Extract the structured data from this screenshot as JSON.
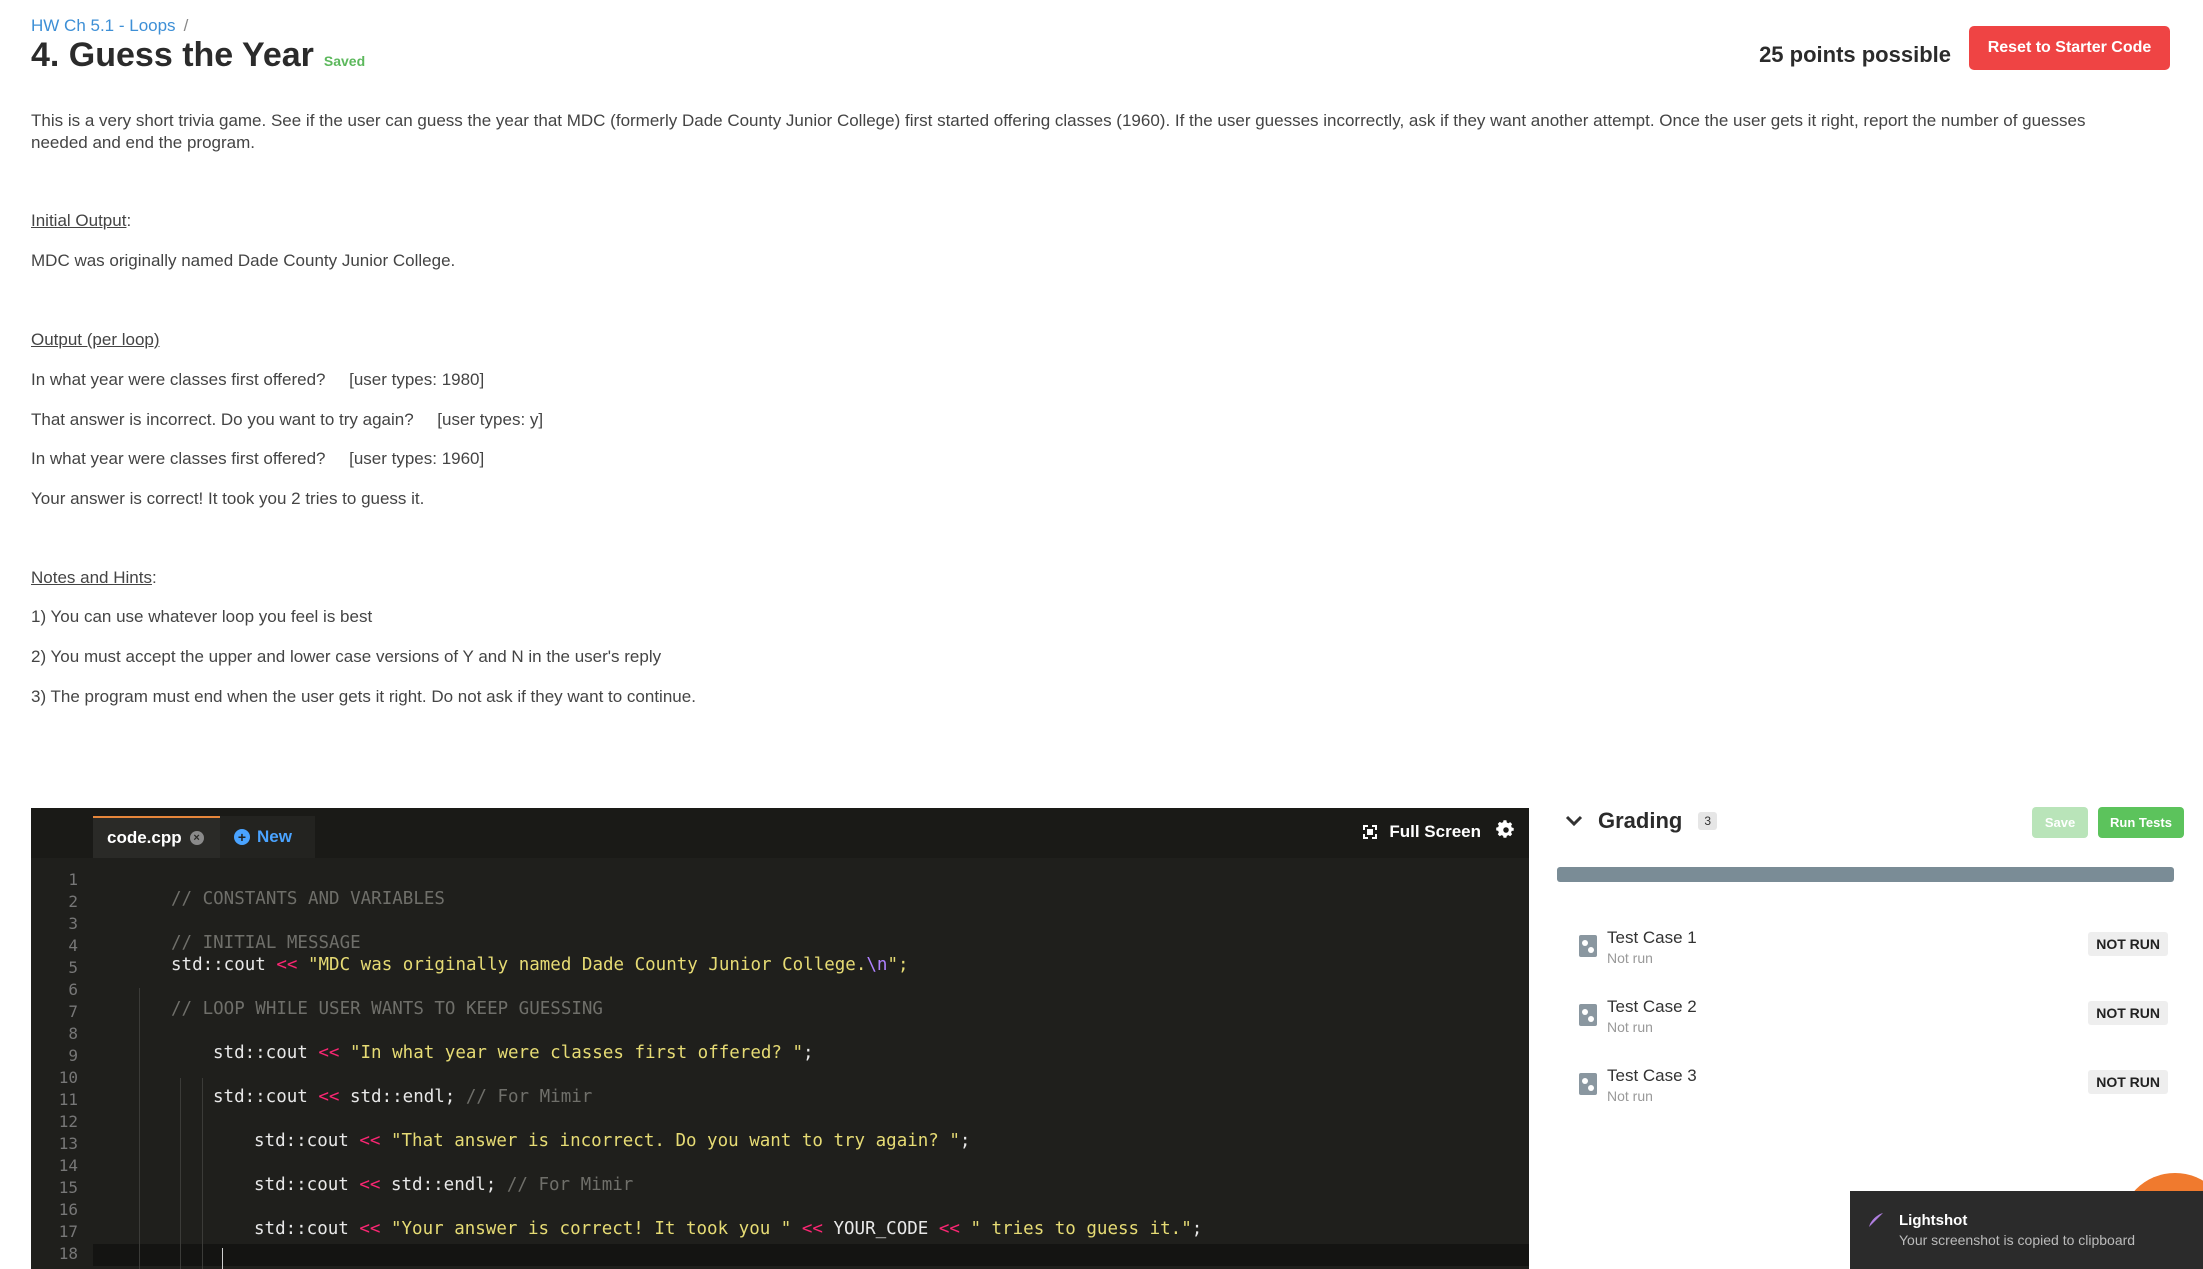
{
  "breadcrumb": {
    "link": "HW Ch 5.1 - Loops",
    "sep": "/"
  },
  "header": {
    "title": "4. Guess the Year",
    "saved": "Saved",
    "points": "25 points possible",
    "reset_label": "Reset to Starter Code"
  },
  "description": "This is a very short trivia game. See if the user can guess the year that MDC (formerly Dade County Junior College) first started offering classes (1960). If the user guesses incorrectly, ask if they want another attempt. Once the user gets it right, report the number of guesses needed and end the program.",
  "initial_output": {
    "heading": "Initial Output",
    "colon": ":",
    "lines": [
      "MDC was originally named Dade County Junior College."
    ]
  },
  "loop_output": {
    "heading": "Output (per loop)",
    "lines": [
      "In what year were classes first offered?     [user types: 1980]",
      "That answer is incorrect. Do you want to try again?     [user types: y]",
      "In what year were classes first offered?     [user types: 1960]",
      "Your answer is correct! It took you 2 tries to guess it."
    ]
  },
  "notes": {
    "heading": "Notes and Hints",
    "colon": ":",
    "lines": [
      "1) You can use whatever loop you feel is best",
      "2) You must accept the upper and lower case versions of Y and N in the user's reply",
      "3) The program must end when the user gets it right. Do not ask if they want to continue."
    ]
  },
  "editor": {
    "file_tab": "code.cpp",
    "new_tab": "New",
    "fullscreen_label": "Full Screen",
    "line_numbers": [
      "1",
      "2",
      "3",
      "4",
      "5",
      "6",
      "7",
      "8",
      "9",
      "10",
      "11",
      "12",
      "13",
      "14",
      "15",
      "16",
      "17",
      "18"
    ],
    "code": {
      "l2": "// CONSTANTS AND VARIABLES",
      "l4": "// INITIAL MESSAGE",
      "l5_a": "std::cout ",
      "l5_op": "<<",
      "l5_str": " \"MDC was originally named Dade County Junior College.",
      "l5_esc": "\\n",
      "l5_end": "\";",
      "l7": "// LOOP WHILE USER WANTS TO KEEP GUESSING",
      "l9_a": "std::cout ",
      "l9_op": "<<",
      "l9_str": " \"In what year were classes first offered? \"",
      "l9_end": ";",
      "l11_a": "std::cout ",
      "l11_op": "<<",
      "l11_b": " std::endl; ",
      "l11_cm": "// For Mimir",
      "l13_a": "std::cout ",
      "l13_op": "<<",
      "l13_str": " \"That answer is incorrect. Do you want to try again? \"",
      "l13_end": ";",
      "l15_a": "std::cout ",
      "l15_op": "<<",
      "l15_b": " std::endl; ",
      "l15_cm": "// For Mimir",
      "l17_a": "std::cout ",
      "l17_op1": "<<",
      "l17_str1": " \"Your answer is correct! It took you \" ",
      "l17_op2": "<<",
      "l17_b": " YOUR_CODE ",
      "l17_op3": "<<",
      "l17_str2": " \" tries to guess it.\"",
      "l17_end": ";"
    }
  },
  "grading": {
    "title": "Grading",
    "count": "3",
    "save_label": "Save",
    "run_label": "Run Tests",
    "tests": [
      {
        "name": "Test Case 1",
        "status": "Not run",
        "badge": "NOT RUN"
      },
      {
        "name": "Test Case 2",
        "status": "Not run",
        "badge": "NOT RUN"
      },
      {
        "name": "Test Case 3",
        "status": "Not run",
        "badge": "NOT RUN"
      }
    ]
  },
  "lightshot": {
    "title": "Lightshot",
    "message": "Your screenshot is copied to clipboard"
  },
  "colors": {
    "accent_red": "#ef4444",
    "link_blue": "#3d8fd6",
    "success_green": "#5cc35c",
    "editor_bg": "#1f1f1c"
  }
}
